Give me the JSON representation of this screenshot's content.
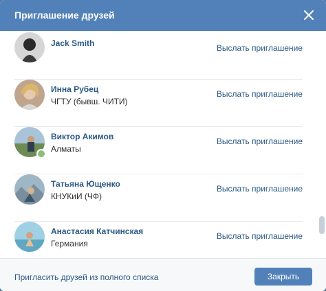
{
  "dialog": {
    "title": "Приглашение друзей"
  },
  "friends": [
    {
      "name": "Jack Smith",
      "subtitle": "",
      "invite": "Выслать приглашение",
      "avatar_color": "#3b3b3b",
      "online": false
    },
    {
      "name": "Инна Рубец",
      "subtitle": "ЧГТУ (бывш. ЧИТИ)",
      "invite": "Выслать приглашение",
      "avatar_color": "#c9a58a",
      "online": false
    },
    {
      "name": "Виктор Акимов",
      "subtitle": "Алматы",
      "invite": "Выслать приглашение",
      "avatar_color": "#6d8c55",
      "online": true
    },
    {
      "name": "Татьяна Ющенко",
      "subtitle": "КНУКиИ (ЧФ)",
      "invite": "Выслать приглашение",
      "avatar_color": "#8aa6b8",
      "online": false
    },
    {
      "name": "Анастасия Катчинская",
      "subtitle": "Германия",
      "invite": "Выслать приглашение",
      "avatar_color": "#7fb3c7",
      "online": false
    }
  ],
  "footer": {
    "invite_all_link": "Пригласить друзей из полного списка",
    "close_button": "Закрыть"
  },
  "colors": {
    "header": "#5181b8",
    "link": "#2a5885",
    "online": "#8ac176"
  }
}
